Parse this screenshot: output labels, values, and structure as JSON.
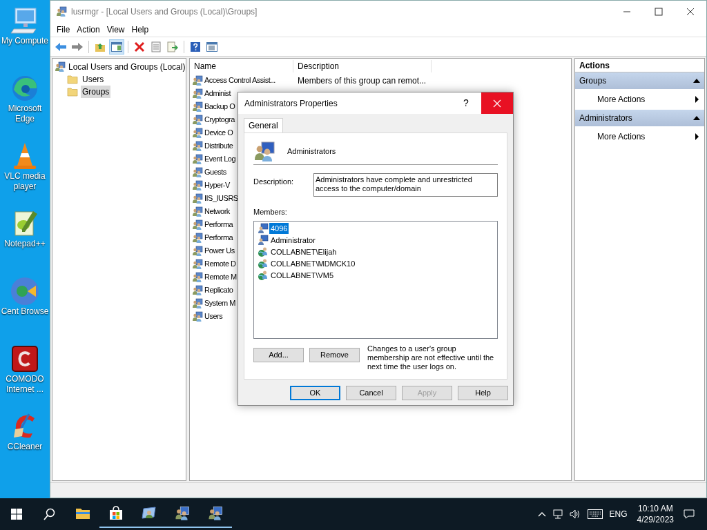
{
  "desktop_icons": [
    {
      "kind": "computer",
      "label": "My Compute"
    },
    {
      "kind": "edge",
      "label": "Microsoft Edge"
    },
    {
      "kind": "vlc",
      "label": "VLC media player"
    },
    {
      "kind": "notepad",
      "label": "Notepad++"
    },
    {
      "kind": "cent",
      "label": "Cent Browse"
    },
    {
      "kind": "comodo",
      "label": "COMODO Internet ..."
    },
    {
      "kind": "ccleaner",
      "label": "CCleaner"
    }
  ],
  "window": {
    "title": "lusrmgr - [Local Users and Groups (Local)\\Groups]"
  },
  "menu": [
    "File",
    "Action",
    "View",
    "Help"
  ],
  "toolbar": [
    {
      "kind": "back",
      "selected": false
    },
    {
      "kind": "forward",
      "selected": false
    },
    {
      "kind": "sep"
    },
    {
      "kind": "up",
      "selected": false
    },
    {
      "kind": "tree",
      "selected": true
    },
    {
      "kind": "sep"
    },
    {
      "kind": "delete",
      "selected": false
    },
    {
      "kind": "properties",
      "selected": false
    },
    {
      "kind": "export",
      "selected": false
    },
    {
      "kind": "sep"
    },
    {
      "kind": "help",
      "selected": false
    },
    {
      "kind": "view",
      "selected": false
    }
  ],
  "tree": {
    "label": "Local Users and Groups (Local)",
    "children": [
      {
        "label": "Users",
        "selected": false
      },
      {
        "label": "Groups",
        "selected": true
      }
    ]
  },
  "list": {
    "columns": [
      "Name",
      "Description"
    ],
    "rows": [
      {
        "name": "Access Control Assist...",
        "description": "Members of this group can remot..."
      },
      {
        "name": "Administ"
      },
      {
        "name": "Backup O"
      },
      {
        "name": "Cryptogra"
      },
      {
        "name": "Device O"
      },
      {
        "name": "Distribute"
      },
      {
        "name": "Event Log"
      },
      {
        "name": "Guests"
      },
      {
        "name": "Hyper-V"
      },
      {
        "name": "IIS_IUSRS"
      },
      {
        "name": "Network"
      },
      {
        "name": "Performa"
      },
      {
        "name": "Performa"
      },
      {
        "name": "Power Us"
      },
      {
        "name": "Remote D"
      },
      {
        "name": "Remote M"
      },
      {
        "name": "Replicato"
      },
      {
        "name": "System M"
      },
      {
        "name": "Users"
      }
    ]
  },
  "actions": {
    "title": "Actions",
    "sections": [
      {
        "title": "Groups",
        "expanded": true,
        "items": [
          "More Actions"
        ]
      },
      {
        "title": "Administrators",
        "expanded": true,
        "items": [
          "More Actions"
        ]
      }
    ]
  },
  "dialog": {
    "title": "Administrators Properties",
    "help": "?",
    "close_hovered": true,
    "tabs": [
      {
        "label": "General",
        "selected": true
      }
    ],
    "group_name": "Administrators",
    "description_label": "Description:",
    "description": "Administrators have complete and unrestricted access to the computer/domain",
    "members_label": "Members:",
    "members": [
      {
        "name": "4096",
        "kind": "local",
        "selected": true
      },
      {
        "name": "Administrator",
        "kind": "local",
        "selected": false
      },
      {
        "name": "COLLABNET\\Elijah",
        "kind": "domain",
        "selected": false
      },
      {
        "name": "COLLABNET\\MDMCK10",
        "kind": "domain",
        "selected": false
      },
      {
        "name": "COLLABNET\\VM5",
        "kind": "domain",
        "selected": false
      }
    ],
    "add_button": "Add...",
    "remove_button": "Remove",
    "note": "Changes to a user's group membership are not effective until the next time the user logs on.",
    "buttons": [
      {
        "label": "OK",
        "default": true,
        "disabled": false
      },
      {
        "label": "Cancel",
        "default": false,
        "disabled": false
      },
      {
        "label": "Apply",
        "default": false,
        "disabled": true
      },
      {
        "label": "Help",
        "default": false,
        "disabled": false
      }
    ]
  },
  "taskbar": {
    "apps": [
      {
        "kind": "explorer",
        "running": false
      },
      {
        "kind": "store",
        "running": true
      },
      {
        "kind": "app",
        "running": true
      },
      {
        "kind": "lusrmgr",
        "running": true
      },
      {
        "kind": "lusrmgr",
        "running": true
      }
    ],
    "language": "ENG",
    "time": "10:10 AM",
    "date": "4/29/2023"
  }
}
